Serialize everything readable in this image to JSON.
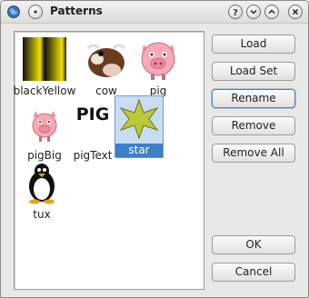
{
  "window": {
    "title": "Patterns",
    "help": "?"
  },
  "patterns": [
    {
      "name": "blackYellow",
      "icon": "black-yellow-gradient"
    },
    {
      "name": "cow",
      "icon": "cow-icon"
    },
    {
      "name": "pig",
      "icon": "pig-icon"
    },
    {
      "name": "pigBig",
      "icon": "pig-icon"
    },
    {
      "name": "pigText",
      "icon": "pig-text",
      "text": "PIG"
    },
    {
      "name": "star",
      "icon": "star-icon",
      "selected": true
    },
    {
      "name": "tux",
      "icon": "penguin-icon"
    }
  ],
  "buttons": {
    "load": "Load",
    "load_set": "Load Set",
    "rename": "Rename",
    "remove": "Remove",
    "remove_all": "Remove All",
    "ok": "OK",
    "cancel": "Cancel"
  },
  "colors": {
    "selection": "#3d7fc9",
    "star": "#bcc83a",
    "pig": "#f6a9b6"
  }
}
